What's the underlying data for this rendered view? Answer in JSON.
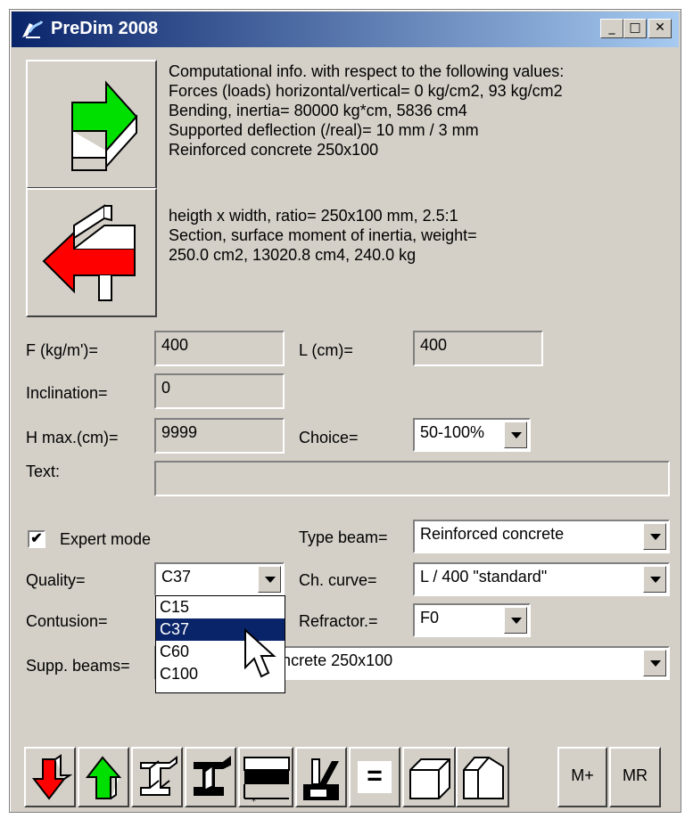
{
  "window": {
    "title": "PreDim 2008",
    "minimize": "_",
    "maximize": "□",
    "close": "✕"
  },
  "info": {
    "lines1": [
      "Computational info. with respect to the following values:",
      "Forces (loads) horizontal/vertical= 0 kg/cm2, 93 kg/cm2",
      "Bending, inertia= 80000 kg*cm, 5836 cm4",
      "Supported deflection (/real)= 10 mm / 3 mm",
      "Reinforced concrete 250x100"
    ],
    "lines2": [
      "heigth x width, ratio= 250x100 mm, 2.5:1",
      "Section, surface moment of inertia, weight=",
      "250.0 cm2, 13020.8 cm4, 240.0 kg"
    ]
  },
  "form": {
    "f_label": "F (kg/m')=",
    "f_value": "400",
    "l_label": "L (cm)=",
    "l_value": "400",
    "incl_label": "Inclination=",
    "incl_value": "0",
    "hmax_label": "H max.(cm)=",
    "hmax_value": "9999",
    "choice_label": "Choice=",
    "choice_value": "50-100%",
    "text_label": "Text:",
    "text_value": "",
    "expert_label": "Expert mode",
    "expert_checked": "✔",
    "typebeam_label": "Type beam=",
    "typebeam_value": "Reinforced concrete",
    "quality_label": "Quality=",
    "quality_value": "C37",
    "chcurve_label": "Ch. curve=",
    "chcurve_value": "L / 400 \"standard\"",
    "contusion_label": "Contusion=",
    "refractor_label": "Refractor.=",
    "refractor_value": "F0",
    "supp_label": "Supp. beams=",
    "supp_value": "Reinforced concrete 250x100"
  },
  "quality_options": [
    "C15",
    "C37",
    "C60",
    "C100"
  ],
  "toolbar": {
    "equals": "=",
    "mplus": "M+",
    "mr": "MR"
  },
  "colors": {
    "green": "#00e000",
    "red": "#ff0000",
    "title_start": "#0a246a",
    "title_end": "#a6caf0",
    "selection": "#0a246a"
  }
}
